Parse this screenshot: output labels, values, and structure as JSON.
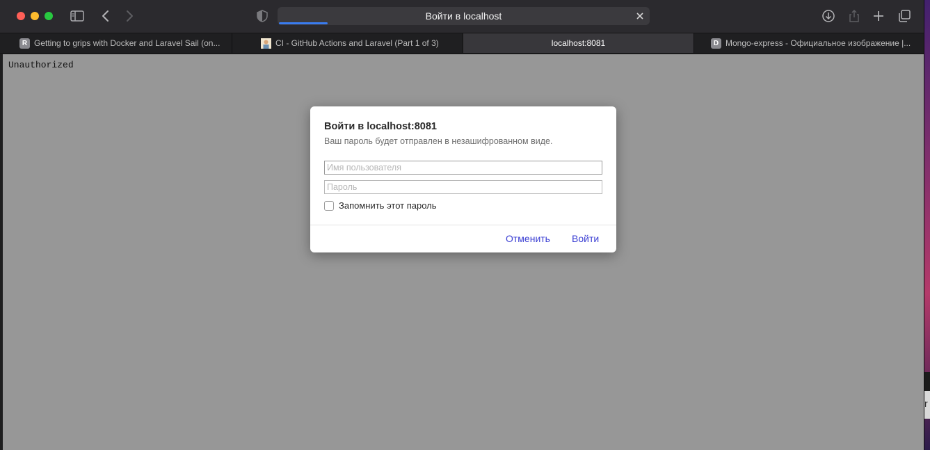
{
  "toolbar": {
    "address_title": "Войти в localhost",
    "progress": 0.13
  },
  "tabs": [
    {
      "favicon": "R",
      "title": "Getting to grips with Docker and Laravel Sail (on..."
    },
    {
      "favicon": "",
      "title": "CI - GitHub Actions and Laravel (Part 1 of 3)"
    },
    {
      "favicon": "",
      "title": "localhost:8081",
      "active": true
    },
    {
      "favicon": "D",
      "title": "Mongo-express - Официальное изображение |..."
    }
  ],
  "page": {
    "body_text": "Unauthorized"
  },
  "dialog": {
    "title": "Войти в localhost:8081",
    "subtitle": "Ваш пароль будет отправлен в незашифрованном виде.",
    "username_placeholder": "Имя пользователя",
    "password_placeholder": "Пароль",
    "remember_label": "Запомнить этот пароль",
    "cancel_label": "Отменить",
    "login_label": "Войти"
  },
  "edge": {
    "char": "r"
  },
  "colors": {
    "accent": "#3b3fd3",
    "progress": "#3a7cf0",
    "page_bg": "#979797"
  }
}
